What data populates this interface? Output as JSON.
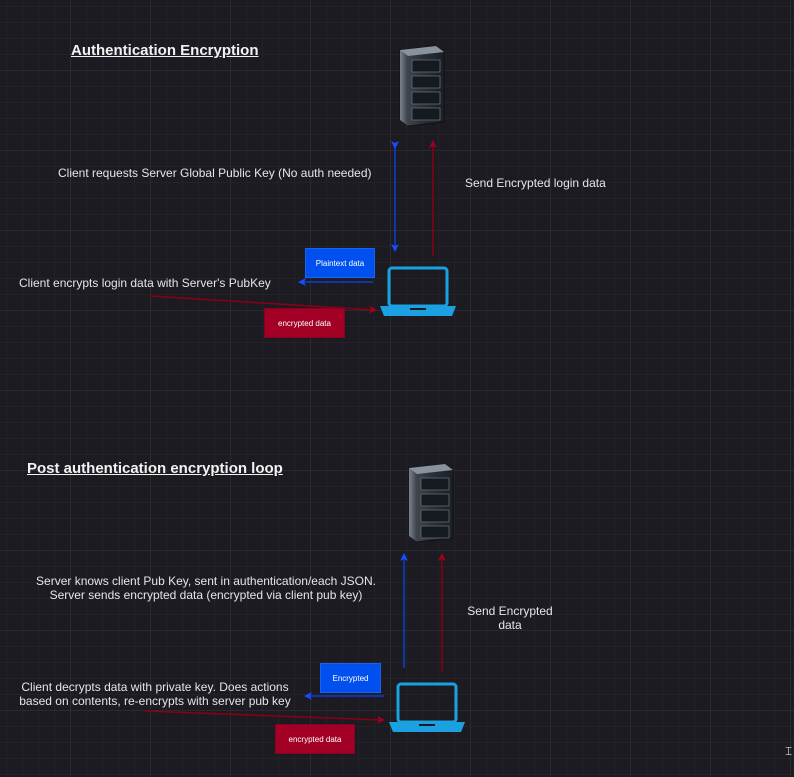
{
  "section1": {
    "title": "Authentication Encryption",
    "label_request": "Client requests Server Global Public Key (No auth needed)",
    "label_send": "Send Encrypted login data",
    "label_encrypts": "Client encrypts login data with Server's PubKey",
    "box_plain": "Plaintext data",
    "box_encrypted": "encrypted data"
  },
  "section2": {
    "title": "Post authentication encryption loop",
    "label_server_line1": "Server knows client Pub Key, sent in authentication/each JSON.",
    "label_server_line2": "Server sends encrypted data (encrypted via client pub key)",
    "label_send_line1": "Send Encrypted",
    "label_send_line2": "data",
    "label_client_line1": "Client decrypts data with private key. Does actions",
    "label_client_line2": "based on contents, re-encrypts with server pub key",
    "box_encrypted_blue": "Encrypted",
    "box_encrypted_red": "encrypted data"
  },
  "colors": {
    "blue_arrow": "#0a3fd6",
    "red_arrow": "#8b0014",
    "laptop": "#1ba1e2",
    "server": "#2f3640"
  },
  "icons": [
    "server-icon",
    "laptop-icon",
    "arrow"
  ]
}
